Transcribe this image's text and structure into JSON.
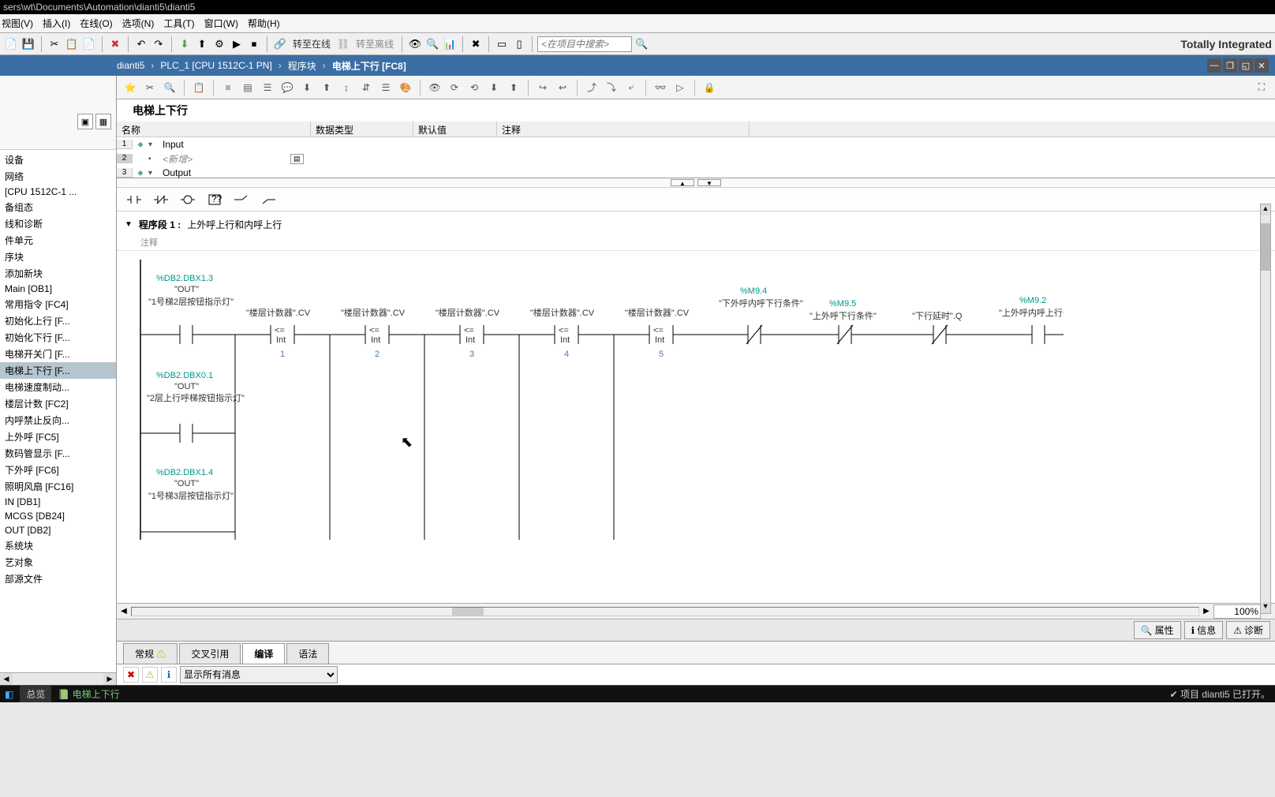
{
  "title_bar": "sers\\wt\\Documents\\Automation\\dianti5\\dianti5",
  "menu": {
    "view": "视图(V)",
    "insert": "插入(I)",
    "online": "在线(O)",
    "options": "选项(N)",
    "tools": "工具(T)",
    "window": "窗口(W)",
    "help": "帮助(H)"
  },
  "toolbar": {
    "go_online": "转至在线",
    "go_offline": "转至离线",
    "search_placeholder": "<在项目中搜索>",
    "brand": "Totally Integrated"
  },
  "breadcrumb": {
    "p0": "dianti5",
    "p1": "PLC_1 [CPU 1512C-1 PN]",
    "p2": "程序块",
    "p3": "电梯上下行 [FC8]"
  },
  "tree": {
    "items": [
      {
        "label": "设备"
      },
      {
        "label": "网络"
      },
      {
        "label": "[CPU 1512C-1 ..."
      },
      {
        "label": "备组态"
      },
      {
        "label": "线和诊断"
      },
      {
        "label": "件单元"
      },
      {
        "label": "序块"
      },
      {
        "label": "添加新块"
      },
      {
        "label": "Main [OB1]"
      },
      {
        "label": "常用指令 [FC4]"
      },
      {
        "label": "初始化上行 [F..."
      },
      {
        "label": "初始化下行 [F..."
      },
      {
        "label": "电梯开关门 [F..."
      },
      {
        "label": "电梯上下行 [F...",
        "sel": true
      },
      {
        "label": "电梯速度制动..."
      },
      {
        "label": "楼层计数 [FC2]"
      },
      {
        "label": "内呼禁止反向..."
      },
      {
        "label": "上外呼 [FC5]"
      },
      {
        "label": "数码管显示 [F..."
      },
      {
        "label": "下外呼 [FC6]"
      },
      {
        "label": "照明风扇 [FC16]"
      },
      {
        "label": "IN [DB1]"
      },
      {
        "label": "MCGS [DB24]"
      },
      {
        "label": "OUT [DB2]"
      },
      {
        "label": "系统块"
      },
      {
        "label": "艺对象"
      },
      {
        "label": "部源文件"
      }
    ]
  },
  "block_title": "电梯上下行",
  "param_table": {
    "cols": {
      "name": "名称",
      "type": "数据类型",
      "default": "默认值",
      "comment": "注释"
    },
    "rows": [
      {
        "n": "1",
        "txt": "Input"
      },
      {
        "n": "2",
        "txt": "<新增>",
        "ph": true
      },
      {
        "n": "3",
        "txt": "Output"
      }
    ]
  },
  "network": {
    "title": "程序段 1 :",
    "desc": "上外呼上行和内呼上行",
    "comment": "注释",
    "contacts": {
      "c1": {
        "addr": "%DB2.DBX1.3",
        "out": "\"OUT\"",
        "label": "\"1号梯2层按钮指示灯\""
      },
      "c2": {
        "addr": "%DB2.DBX0.1",
        "out": "\"OUT\"",
        "label": "\"2层上行呼梯按钮指示灯\""
      },
      "c3": {
        "addr": "%DB2.DBX1.4",
        "out": "\"OUT\"",
        "label": "\"1号梯3层按钮指示灯\""
      }
    },
    "compares": [
      {
        "label": "\"楼层计数器\".CV",
        "op": "<=",
        "t": "Int",
        "v": "1"
      },
      {
        "label": "\"楼层计数器\".CV",
        "op": "<=",
        "t": "Int",
        "v": "2"
      },
      {
        "label": "\"楼层计数器\".CV",
        "op": "<=",
        "t": "Int",
        "v": "3"
      },
      {
        "label": "\"楼层计数器\".CV",
        "op": "<=",
        "t": "Int",
        "v": "4"
      },
      {
        "label": "\"楼层计数器\".CV",
        "op": "<=",
        "t": "Int",
        "v": "5"
      }
    ],
    "coils": [
      {
        "addr": "%M9.4",
        "label": "\"下外呼内呼下行条件\""
      },
      {
        "addr": "%M9.5",
        "label": "\"上外呼下行条件\""
      },
      {
        "addr": "",
        "label": "\"下行延时\".Q"
      },
      {
        "addr": "%M9.2",
        "label": "\"上外呼内呼上行条件\""
      }
    ]
  },
  "zoom": "100%",
  "info_tabs": {
    "props": "属性",
    "info": "信息",
    "diag": "诊断"
  },
  "tabs2": {
    "general": "常规",
    "xref": "交叉引用",
    "compile": "编译",
    "syntax": "语法"
  },
  "msg_filter": "显示所有消息",
  "status": {
    "overview": "总览",
    "current": "电梯上下行",
    "project": "项目 dianti5 已打开。"
  }
}
